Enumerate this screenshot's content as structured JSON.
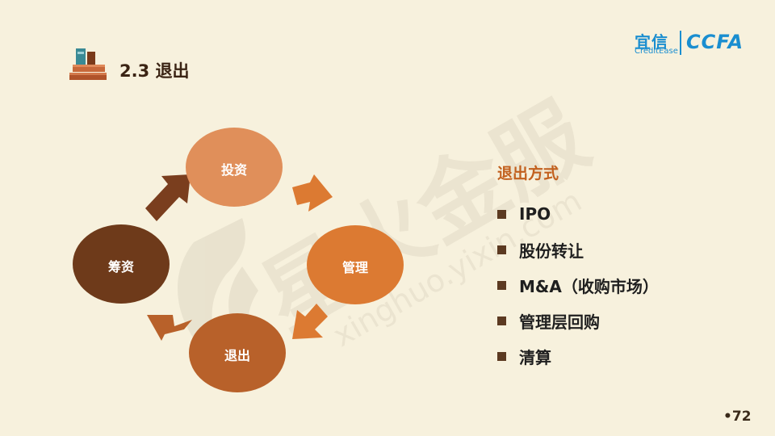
{
  "header": {
    "title": "2.3 退出"
  },
  "logo": {
    "cn": "宜信",
    "en": "CreditEase",
    "ccfa": "CCFA"
  },
  "watermark": {
    "cn": "星火金服",
    "url": "xinghuo.yixin.com"
  },
  "cycle": {
    "nodes": [
      {
        "label": "投资",
        "color": "#e08f5a"
      },
      {
        "label": "管理",
        "color": "#dc7a32"
      },
      {
        "label": "退出",
        "color": "#b8612a"
      },
      {
        "label": "筹资",
        "color": "#6e3a1a"
      }
    ]
  },
  "exit_methods": {
    "heading": "退出方式",
    "items": [
      "IPO",
      "股份转让",
      "M&A（收购市场）",
      "管理层回购",
      "清算"
    ]
  },
  "page_number": "•72",
  "colors": {
    "background": "#f7f1dd",
    "accent": "#c2601e",
    "bullet": "#5c3a21",
    "brand": "#1a8ed0"
  }
}
